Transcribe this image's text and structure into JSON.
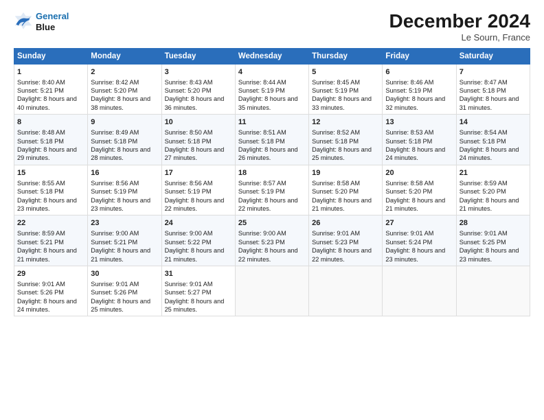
{
  "logo": {
    "line1": "General",
    "line2": "Blue"
  },
  "title": "December 2024",
  "location": "Le Sourn, France",
  "weekdays": [
    "Sunday",
    "Monday",
    "Tuesday",
    "Wednesday",
    "Thursday",
    "Friday",
    "Saturday"
  ],
  "weeks": [
    [
      {
        "day": 1,
        "sunrise": "8:40 AM",
        "sunset": "5:21 PM",
        "daylight": "8 hours and 40 minutes."
      },
      {
        "day": 2,
        "sunrise": "8:42 AM",
        "sunset": "5:20 PM",
        "daylight": "8 hours and 38 minutes."
      },
      {
        "day": 3,
        "sunrise": "8:43 AM",
        "sunset": "5:20 PM",
        "daylight": "8 hours and 36 minutes."
      },
      {
        "day": 4,
        "sunrise": "8:44 AM",
        "sunset": "5:19 PM",
        "daylight": "8 hours and 35 minutes."
      },
      {
        "day": 5,
        "sunrise": "8:45 AM",
        "sunset": "5:19 PM",
        "daylight": "8 hours and 33 minutes."
      },
      {
        "day": 6,
        "sunrise": "8:46 AM",
        "sunset": "5:19 PM",
        "daylight": "8 hours and 32 minutes."
      },
      {
        "day": 7,
        "sunrise": "8:47 AM",
        "sunset": "5:18 PM",
        "daylight": "8 hours and 31 minutes."
      }
    ],
    [
      {
        "day": 8,
        "sunrise": "8:48 AM",
        "sunset": "5:18 PM",
        "daylight": "8 hours and 29 minutes."
      },
      {
        "day": 9,
        "sunrise": "8:49 AM",
        "sunset": "5:18 PM",
        "daylight": "8 hours and 28 minutes."
      },
      {
        "day": 10,
        "sunrise": "8:50 AM",
        "sunset": "5:18 PM",
        "daylight": "8 hours and 27 minutes."
      },
      {
        "day": 11,
        "sunrise": "8:51 AM",
        "sunset": "5:18 PM",
        "daylight": "8 hours and 26 minutes."
      },
      {
        "day": 12,
        "sunrise": "8:52 AM",
        "sunset": "5:18 PM",
        "daylight": "8 hours and 25 minutes."
      },
      {
        "day": 13,
        "sunrise": "8:53 AM",
        "sunset": "5:18 PM",
        "daylight": "8 hours and 24 minutes."
      },
      {
        "day": 14,
        "sunrise": "8:54 AM",
        "sunset": "5:18 PM",
        "daylight": "8 hours and 24 minutes."
      }
    ],
    [
      {
        "day": 15,
        "sunrise": "8:55 AM",
        "sunset": "5:18 PM",
        "daylight": "8 hours and 23 minutes."
      },
      {
        "day": 16,
        "sunrise": "8:56 AM",
        "sunset": "5:19 PM",
        "daylight": "8 hours and 23 minutes."
      },
      {
        "day": 17,
        "sunrise": "8:56 AM",
        "sunset": "5:19 PM",
        "daylight": "8 hours and 22 minutes."
      },
      {
        "day": 18,
        "sunrise": "8:57 AM",
        "sunset": "5:19 PM",
        "daylight": "8 hours and 22 minutes."
      },
      {
        "day": 19,
        "sunrise": "8:58 AM",
        "sunset": "5:20 PM",
        "daylight": "8 hours and 21 minutes."
      },
      {
        "day": 20,
        "sunrise": "8:58 AM",
        "sunset": "5:20 PM",
        "daylight": "8 hours and 21 minutes."
      },
      {
        "day": 21,
        "sunrise": "8:59 AM",
        "sunset": "5:20 PM",
        "daylight": "8 hours and 21 minutes."
      }
    ],
    [
      {
        "day": 22,
        "sunrise": "8:59 AM",
        "sunset": "5:21 PM",
        "daylight": "8 hours and 21 minutes."
      },
      {
        "day": 23,
        "sunrise": "9:00 AM",
        "sunset": "5:21 PM",
        "daylight": "8 hours and 21 minutes."
      },
      {
        "day": 24,
        "sunrise": "9:00 AM",
        "sunset": "5:22 PM",
        "daylight": "8 hours and 21 minutes."
      },
      {
        "day": 25,
        "sunrise": "9:00 AM",
        "sunset": "5:23 PM",
        "daylight": "8 hours and 22 minutes."
      },
      {
        "day": 26,
        "sunrise": "9:01 AM",
        "sunset": "5:23 PM",
        "daylight": "8 hours and 22 minutes."
      },
      {
        "day": 27,
        "sunrise": "9:01 AM",
        "sunset": "5:24 PM",
        "daylight": "8 hours and 23 minutes."
      },
      {
        "day": 28,
        "sunrise": "9:01 AM",
        "sunset": "5:25 PM",
        "daylight": "8 hours and 23 minutes."
      }
    ],
    [
      {
        "day": 29,
        "sunrise": "9:01 AM",
        "sunset": "5:26 PM",
        "daylight": "8 hours and 24 minutes."
      },
      {
        "day": 30,
        "sunrise": "9:01 AM",
        "sunset": "5:26 PM",
        "daylight": "8 hours and 25 minutes."
      },
      {
        "day": 31,
        "sunrise": "9:01 AM",
        "sunset": "5:27 PM",
        "daylight": "8 hours and 25 minutes."
      },
      null,
      null,
      null,
      null
    ]
  ]
}
